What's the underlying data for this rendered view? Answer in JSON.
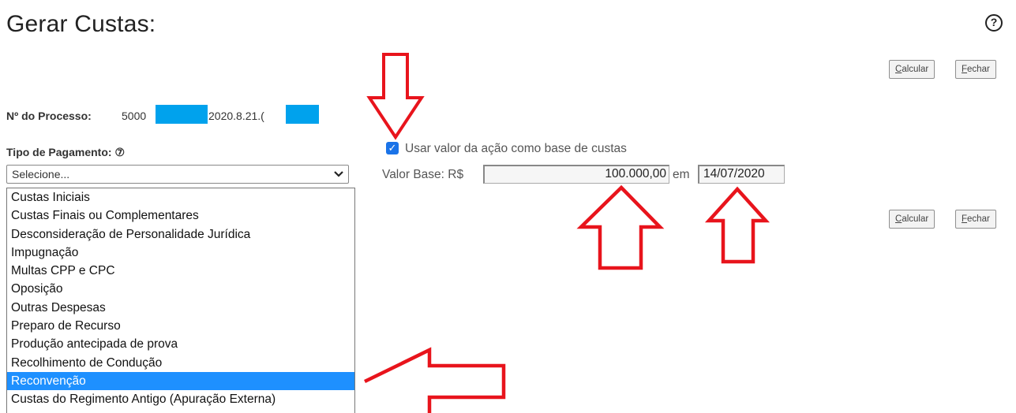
{
  "header": {
    "title": "Gerar Custas:",
    "help_icon": "?"
  },
  "toolbar": {
    "calcular_label": "Calcular",
    "calcular_accesskey": "C",
    "calcular_rest": "alcular",
    "fechar_accesskey": "F",
    "fechar_rest": "echar"
  },
  "processo": {
    "label": "Nº do Processo:",
    "part1": "5000",
    "part2": "2020.8.21.("
  },
  "pagamento": {
    "label": "Tipo de Pagamento:",
    "help_icon": "⑦",
    "selected_value": "Selecione...",
    "options": [
      "Custas Iniciais",
      "Custas Finais ou Complementares",
      "Desconsideração de Personalidade Jurídica",
      "Impugnação",
      "Multas CPP e CPC",
      "Oposição",
      "Outras Despesas",
      "Preparo de Recurso",
      "Produção antecipada de prova",
      "Recolhimento de Condução",
      "Reconvenção",
      "Custas do Regimento Antigo (Apuração Externa)"
    ],
    "highlighted_option": "Reconvenção"
  },
  "valor": {
    "checkbox_label": "Usar valor da ação como base de custas",
    "checkbox_checked": true,
    "base_label": "Valor Base: R$",
    "base_value": "100.000,00",
    "em_label": "em",
    "date_value": "14/07/2020"
  },
  "annotations": {
    "arrow_color": "#e8141c"
  }
}
